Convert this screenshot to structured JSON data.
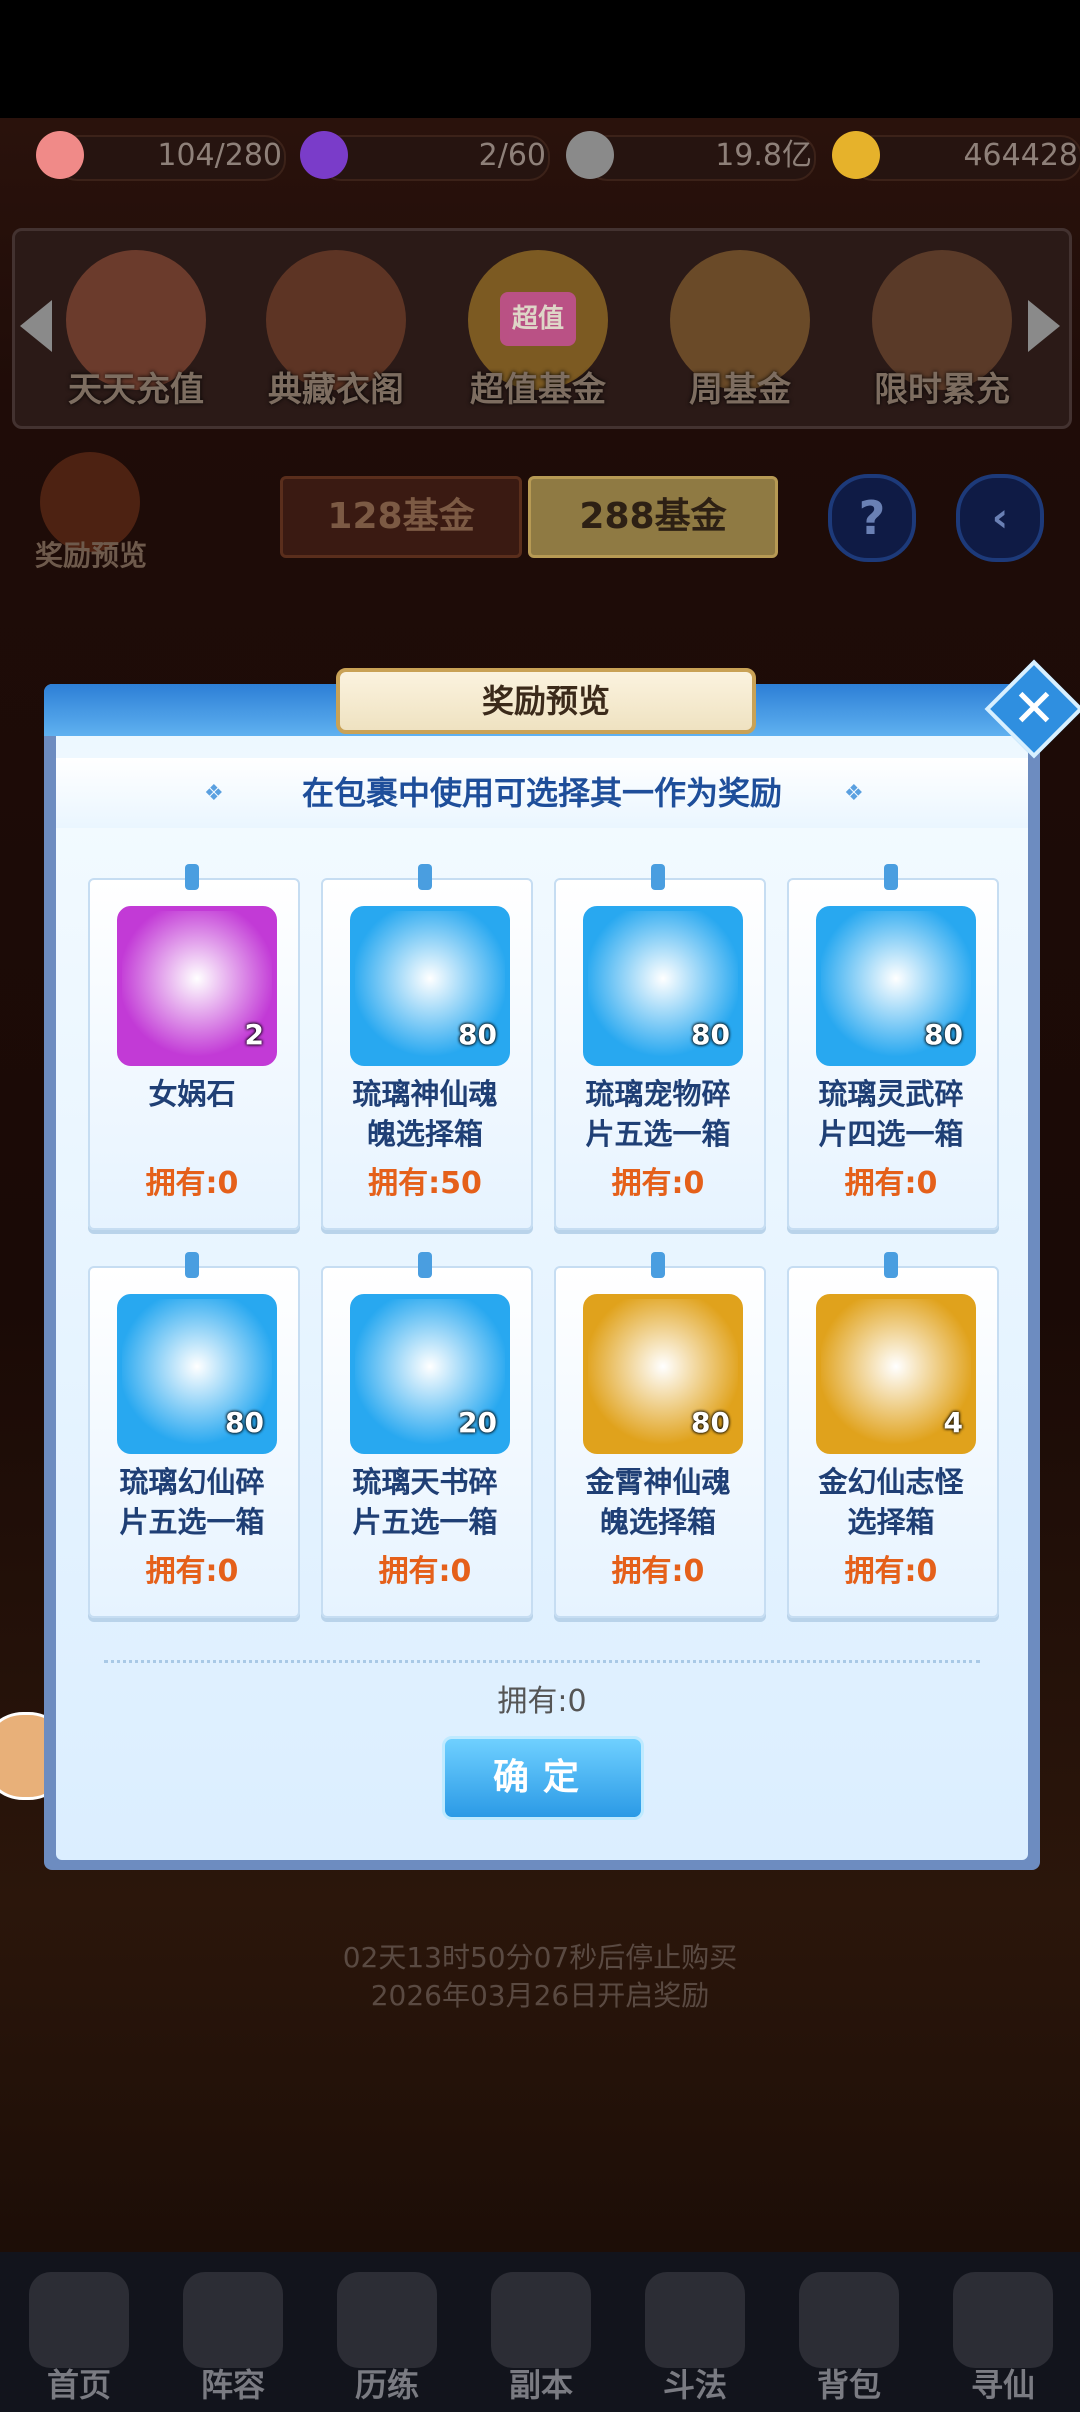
{
  "resources": [
    {
      "icon": "peach-icon",
      "value": "104/280",
      "color": "#f08a88"
    },
    {
      "icon": "spirit-flame-icon",
      "value": "2/60",
      "color": "#7a3cc9"
    },
    {
      "icon": "coin-icon",
      "value": "19.8亿",
      "color": "#8a8a8a"
    },
    {
      "icon": "gold-ingot-icon",
      "value": "464428",
      "color": "#e6b22b"
    }
  ],
  "categories": [
    {
      "label": "天天充值"
    },
    {
      "label": "典藏衣阁"
    },
    {
      "label": "超值基金",
      "badge": "超值"
    },
    {
      "label": "周基金"
    },
    {
      "label": "限时累充"
    }
  ],
  "reward_preview_label": "奖励预览",
  "fund_tabs": [
    {
      "label": "128基金"
    },
    {
      "label": "288基金"
    }
  ],
  "help_symbol": "?",
  "background_text": {
    "countdown": "02天13时50分07秒后停止购买",
    "reward_date": "2026年03月26日开启奖励"
  },
  "modal": {
    "title": "奖励预览",
    "subtitle": "在包裹中使用可选择其一作为奖励",
    "items": [
      {
        "name": "女娲石",
        "qty": "2",
        "owned": "拥有:0",
        "frame": "#c23ad6",
        "icon": "crystal-icon"
      },
      {
        "name": "琉璃神仙魂魄选择箱",
        "qty": "80",
        "owned": "拥有:50",
        "frame": "#28a8f0",
        "icon": "chest-icon"
      },
      {
        "name": "琉璃宠物碎片五选一箱",
        "qty": "80",
        "owned": "拥有:0",
        "frame": "#28a8f0",
        "icon": "chest-icon"
      },
      {
        "name": "琉璃灵武碎片四选一箱",
        "qty": "80",
        "owned": "拥有:0",
        "frame": "#28a8f0",
        "icon": "chest-icon"
      },
      {
        "name": "琉璃幻仙碎片五选一箱",
        "qty": "80",
        "owned": "拥有:0",
        "frame": "#28a8f0",
        "icon": "chest-icon"
      },
      {
        "name": "琉璃天书碎片五选一箱",
        "qty": "20",
        "owned": "拥有:0",
        "frame": "#28a8f0",
        "icon": "bag-icon"
      },
      {
        "name": "金霄神仙魂魄选择箱",
        "qty": "80",
        "owned": "拥有:0",
        "frame": "#e0a21c",
        "icon": "chest-icon"
      },
      {
        "name": "金幻仙志怪选择箱",
        "qty": "4",
        "owned": "拥有:0",
        "frame": "#e0a21c",
        "icon": "treasure-chest-icon"
      }
    ],
    "owned_total": "拥有:0",
    "confirm_label": "确定"
  },
  "bottom_nav": [
    {
      "label": "首页"
    },
    {
      "label": "阵容"
    },
    {
      "label": "历练"
    },
    {
      "label": "副本"
    },
    {
      "label": "斗法"
    },
    {
      "label": "背包"
    },
    {
      "label": "寻仙"
    }
  ]
}
